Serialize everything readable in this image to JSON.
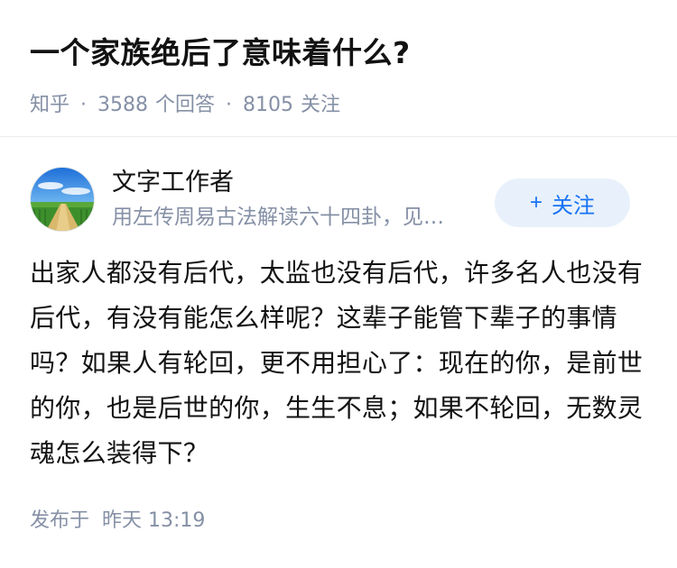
{
  "question": {
    "title": "一个家族绝后了意味着什么?",
    "source": "知乎",
    "answer_count": "3588",
    "answer_label": "个回答",
    "follow_count": "8105",
    "follow_label": "关注"
  },
  "answer": {
    "author": {
      "name": "文字工作者",
      "headline": "用左传周易古法解读六十四卦，见…",
      "avatar_icon": "avatar-landscape-path-icon"
    },
    "follow_button": {
      "icon": "+",
      "label": "关注"
    },
    "content": "出家人都没有后代，太监也没有后代，许多名人也没有后代，有没有能怎么样呢？这辈子能管下辈子的事情吗？如果人有轮回，更不用担心了：现在的你，是前世的你，也是后世的你，生生不息；如果不轮回，无数灵魂怎么装得下？",
    "publish": {
      "label": "发布于",
      "time": "昨天 13:19"
    }
  },
  "colors": {
    "text_primary": "#121212",
    "text_secondary": "#8590a6",
    "accent": "#1772f6",
    "button_bg": "#e8f1fb",
    "divider": "#ebebeb"
  }
}
